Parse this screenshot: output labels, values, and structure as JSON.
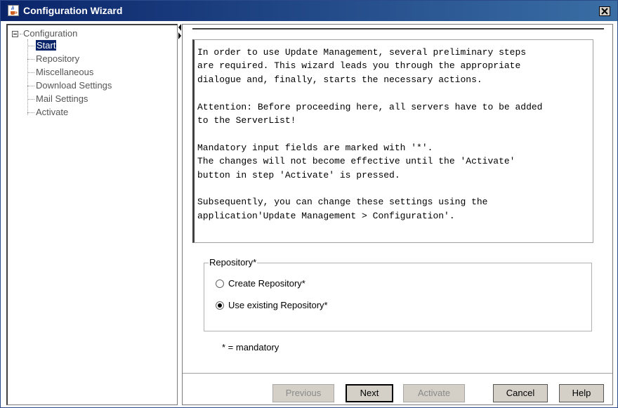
{
  "window": {
    "title": "Configuration Wizard",
    "app_icon": "java-cup-icon",
    "close_icon": "close-icon"
  },
  "tree": {
    "root_label": "Configuration",
    "items": [
      {
        "label": "Start",
        "selected": true
      },
      {
        "label": "Repository",
        "selected": false
      },
      {
        "label": "Miscellaneous",
        "selected": false
      },
      {
        "label": "Download Settings",
        "selected": false
      },
      {
        "label": "Mail Settings",
        "selected": false
      },
      {
        "label": "Activate",
        "selected": false
      }
    ]
  },
  "intro_text": "In order to use Update Management, several preliminary steps\nare required. This wizard leads you through the appropriate\ndialogue and, finally, starts the necessary actions.\n\nAttention: Before proceeding here, all servers have to be added\nto the ServerList!\n\nMandatory input fields are marked with '*'.\nThe changes will not become effective until the 'Activate'\nbutton in step 'Activate' is pressed.\n\nSubsequently, you can change these settings using the\napplication'Update Management > Configuration'.",
  "repository_group": {
    "legend": "Repository*",
    "options": [
      {
        "label": "Create Repository*",
        "checked": false
      },
      {
        "label": "Use existing Repository*",
        "checked": true
      }
    ]
  },
  "mandatory_note": "* = mandatory",
  "buttons": {
    "previous": "Previous",
    "next": "Next",
    "activate": "Activate",
    "cancel": "Cancel",
    "help": "Help"
  },
  "colors": {
    "title_bar": "#0a246a",
    "selection": "#0a246a",
    "disabled_text": "#8a8a8a"
  }
}
